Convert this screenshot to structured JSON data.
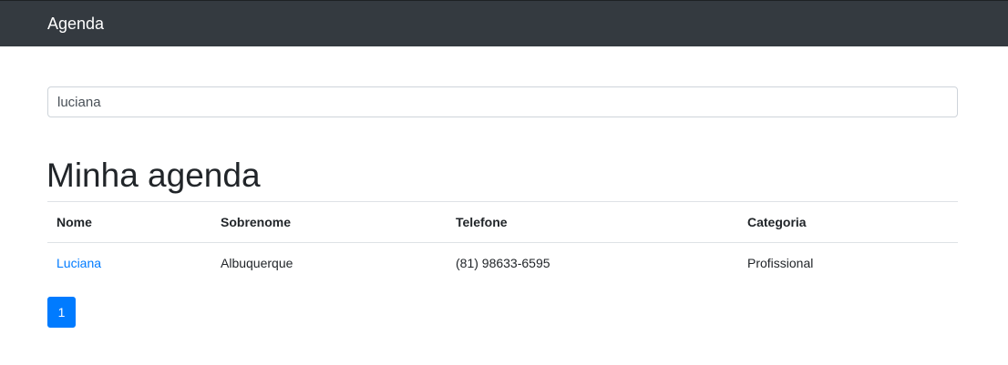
{
  "navbar": {
    "brand": "Agenda"
  },
  "search": {
    "value": "luciana",
    "placeholder": ""
  },
  "main": {
    "title": "Minha agenda",
    "table": {
      "columns": [
        "Nome",
        "Sobrenome",
        "Telefone",
        "Categoria"
      ],
      "rows": [
        {
          "nome": "Luciana",
          "sobrenome": "Albuquerque",
          "telefone": "(81) 98633-6595",
          "categoria": "Profissional"
        }
      ]
    },
    "pagination": {
      "current_page": "1"
    }
  },
  "colors": {
    "navbar_bg": "#343a40",
    "link": "#007bff",
    "active_page": "#007bff"
  }
}
